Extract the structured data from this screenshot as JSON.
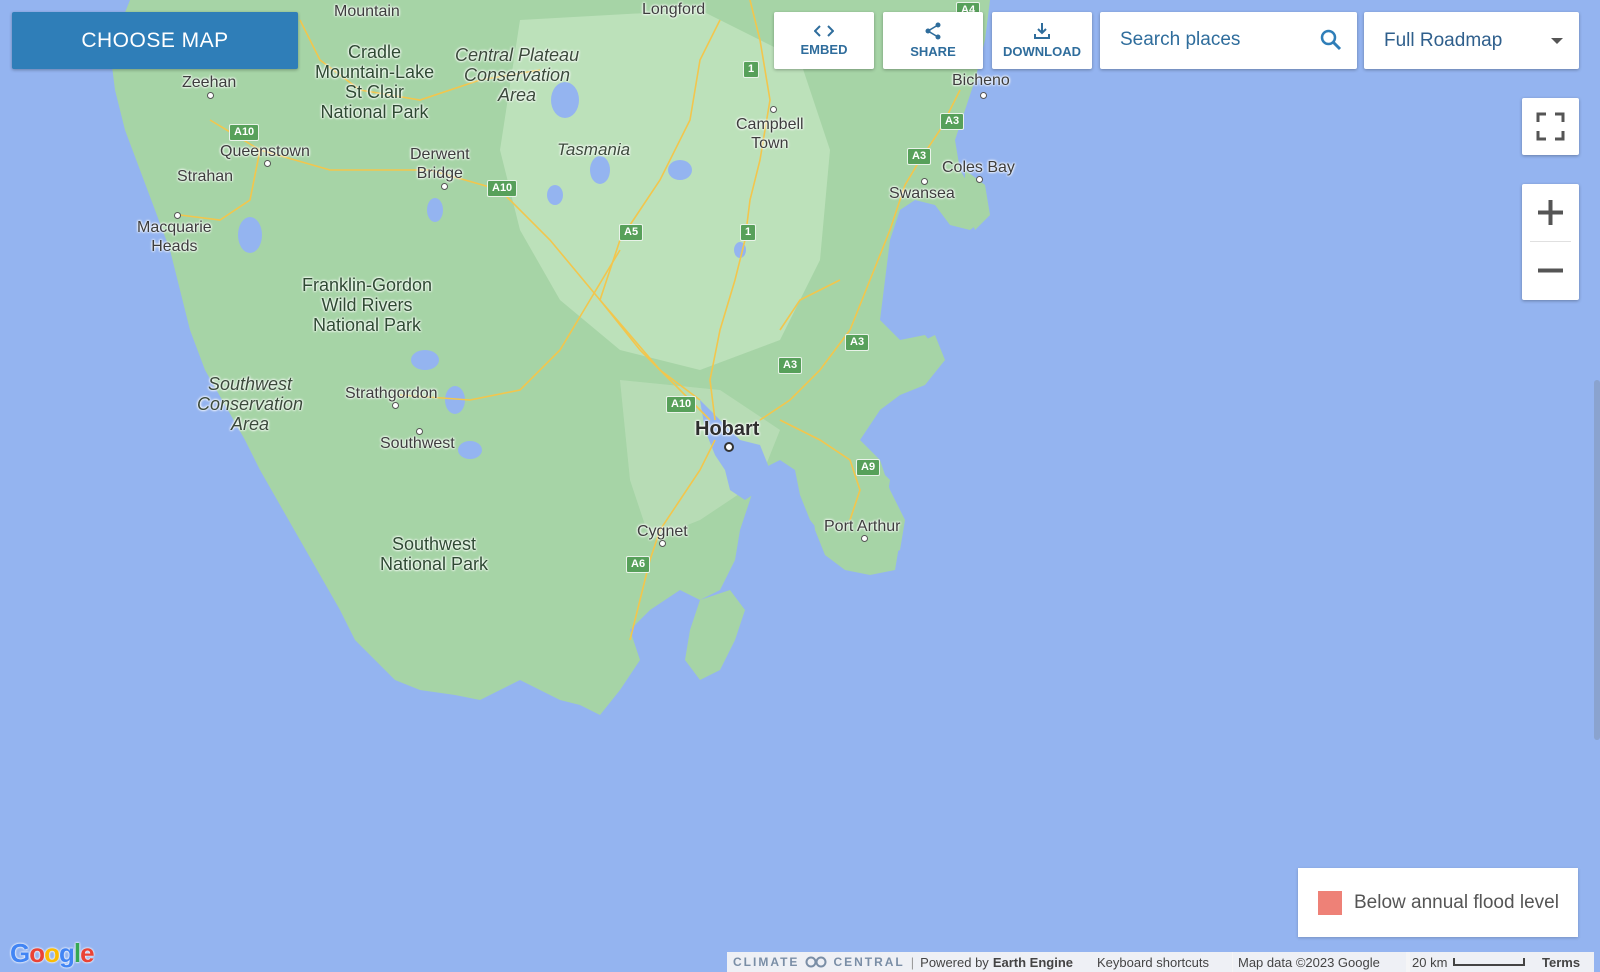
{
  "toolbar": {
    "choose_map": "CHOOSE MAP",
    "embed": "EMBED",
    "share": "SHARE",
    "download": "DOWNLOAD",
    "search_placeholder": "Search places",
    "layer_select": "Full Roadmap"
  },
  "legend": {
    "label": "Below annual flood level",
    "color": "#ee8177"
  },
  "map": {
    "places": {
      "longford": "Longford",
      "mountain": "Mountain",
      "cradle1": "Cradle",
      "cradle2": "Mountain-Lake",
      "cradle3": "St Clair",
      "cradle4": "National Park",
      "central1": "Central Plateau",
      "central2": "Conservation",
      "central3": "Area",
      "zeehan": "Zeehan",
      "queenstown": "Queenstown",
      "strahan": "Strahan",
      "macq1": "Macquarie",
      "macq2": "Heads",
      "derwent1": "Derwent",
      "derwent2": "Bridge",
      "tasmania": "Tasmania",
      "campbell1": "Campbell",
      "campbell2": "Town",
      "bicheno": "Bicheno",
      "coles": "Coles Bay",
      "swansea": "Swansea",
      "franklin1": "Franklin-Gordon",
      "franklin2": "Wild Rivers",
      "franklin3": "National Park",
      "swca1": "Southwest",
      "swca2": "Conservation",
      "swca3": "Area",
      "strathgordon": "Strathgordon",
      "southwest": "Southwest",
      "hobart": "Hobart",
      "cygnet": "Cygnet",
      "portarthur": "Port Arthur",
      "swnp1": "Southwest",
      "swnp2": "National Park"
    },
    "shields": {
      "a4": "A4",
      "r1a": "1",
      "r1b": "1",
      "a10a": "A10",
      "a10b": "A10",
      "a10c": "A10",
      "a5": "A5",
      "a3a": "A3",
      "a3b": "A3",
      "a3c": "A3",
      "a3d": "A3",
      "a9": "A9",
      "a6": "A6"
    }
  },
  "footer": {
    "brand_left": "CLIMATE",
    "brand_right": "CENTRAL",
    "powered_prefix": "Powered by",
    "powered_engine": "Earth Engine",
    "shortcuts": "Keyboard shortcuts",
    "mapdata": "Map data ©2023 Google",
    "scale": "20 km",
    "terms": "Terms"
  },
  "google_logo": {
    "G": "G",
    "o1": "o",
    "o2": "o",
    "g": "g",
    "l": "l",
    "e": "e"
  },
  "colors": {
    "water": "#94b4f0",
    "land": "#a3d3a6",
    "land_light": "#c9e6c5",
    "road": "#f2c64d",
    "button_blue": "#2f7eb8"
  }
}
